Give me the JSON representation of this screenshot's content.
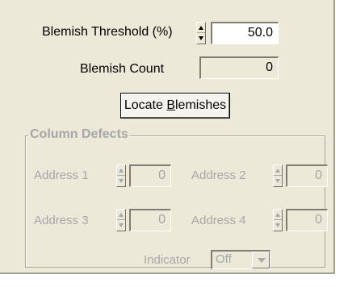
{
  "blemish": {
    "threshold_label": "Blemish Threshold (%)",
    "threshold_value": "50.0",
    "count_label": "Blemish Count",
    "count_value": "0",
    "locate_button_prefix": "Locate ",
    "locate_button_underlined": "B",
    "locate_button_suffix": "lemishes"
  },
  "column_defects": {
    "title": "Column Defects",
    "address1_label": "Address 1",
    "address1_value": "0",
    "address2_label": "Address 2",
    "address2_value": "0",
    "address3_label": "Address 3",
    "address3_value": "0",
    "address4_label": "Address 4",
    "address4_value": "0",
    "indicator_label": "Indicator",
    "indicator_value": "Off"
  },
  "colors": {
    "panel_bg": "#ece9d8",
    "disabled_text": "#a7a6aa"
  }
}
